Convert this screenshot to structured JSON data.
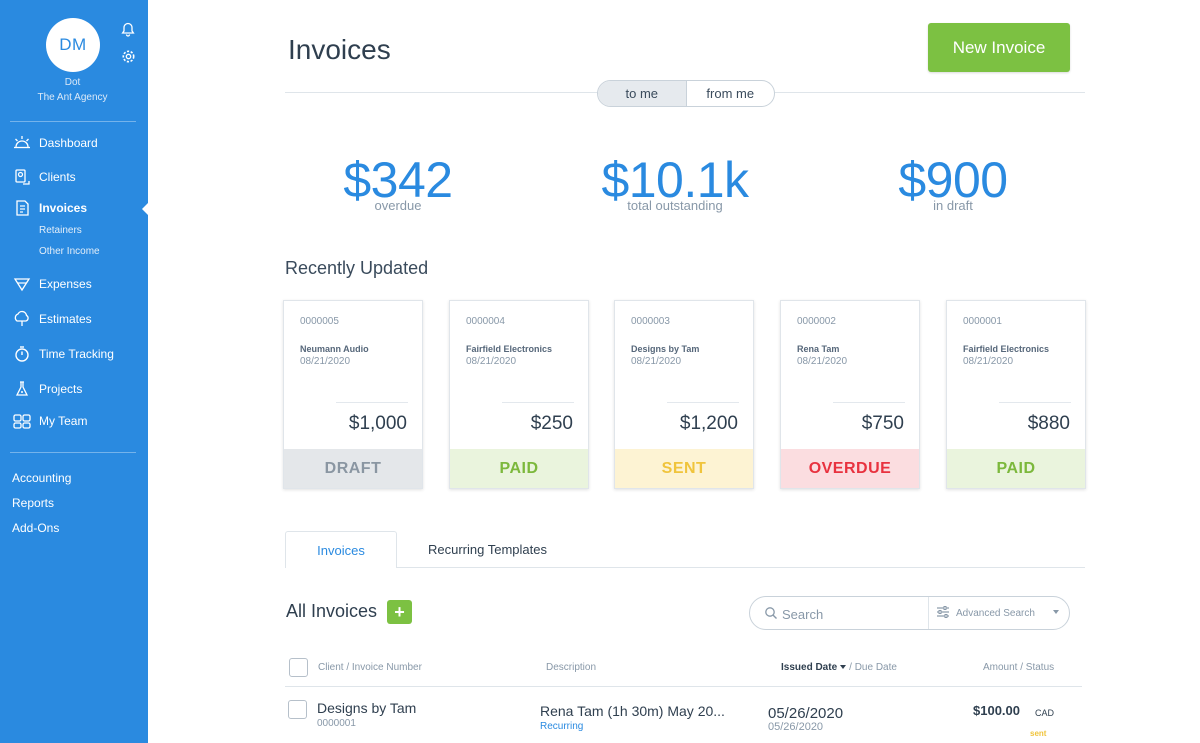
{
  "sidebar": {
    "avatar_initials": "DM",
    "user_name": "Dot",
    "user_org": "The Ant Agency",
    "nav": [
      {
        "label": "Dashboard",
        "icon": "sunrise-icon"
      },
      {
        "label": "Clients",
        "icon": "clients-icon"
      },
      {
        "label": "Invoices",
        "icon": "invoice-icon"
      },
      {
        "label": "Expenses",
        "icon": "expenses-icon"
      },
      {
        "label": "Estimates",
        "icon": "estimates-icon"
      },
      {
        "label": "Time Tracking",
        "icon": "clock-icon"
      },
      {
        "label": "Projects",
        "icon": "flask-icon"
      },
      {
        "label": "My Team",
        "icon": "team-icon"
      }
    ],
    "invoice_sub": [
      "Retainers",
      "Other Income"
    ],
    "bottom": [
      "Accounting",
      "Reports",
      "Add-Ons"
    ]
  },
  "header": {
    "title": "Invoices",
    "new_invoice": "New Invoice",
    "toggle": [
      "to me",
      "from me"
    ]
  },
  "stats": [
    {
      "value": "$342",
      "label": "overdue"
    },
    {
      "value": "$10.1k",
      "label": "total outstanding"
    },
    {
      "value": "$900",
      "label": "in draft"
    }
  ],
  "recent": {
    "title": "Recently Updated",
    "cards": [
      {
        "number": "0000005",
        "client": "Neumann Audio",
        "date": "08/21/2020",
        "amount": "$1,000",
        "status": "DRAFT"
      },
      {
        "number": "0000004",
        "client": "Fairfield Electronics",
        "date": "08/21/2020",
        "amount": "$250",
        "status": "PAID"
      },
      {
        "number": "0000003",
        "client": "Designs by Tam",
        "date": "08/21/2020",
        "amount": "$1,200",
        "status": "SENT"
      },
      {
        "number": "0000002",
        "client": "Rena Tam",
        "date": "08/21/2020",
        "amount": "$750",
        "status": "OVERDUE"
      },
      {
        "number": "0000001",
        "client": "Fairfield Electronics",
        "date": "08/21/2020",
        "amount": "$880",
        "status": "PAID"
      }
    ]
  },
  "tabs": [
    "Invoices",
    "Recurring Templates"
  ],
  "list": {
    "title": "All Invoices",
    "add": "+",
    "search_placeholder": "Search",
    "advanced_search": "Advanced Search",
    "columns": {
      "client": "Client / Invoice Number",
      "description": "Description",
      "issued": "Issued Date",
      "due": "/ Due Date",
      "amount": "Amount / Status"
    },
    "rows": [
      {
        "client": "Designs by Tam",
        "number": "0000001",
        "description": "Rena Tam (1h 30m) May 20...",
        "tag": "Recurring",
        "issued": "05/26/2020",
        "due": "05/26/2020",
        "amount": "$100.00",
        "currency": "CAD",
        "status": "sent"
      }
    ]
  }
}
